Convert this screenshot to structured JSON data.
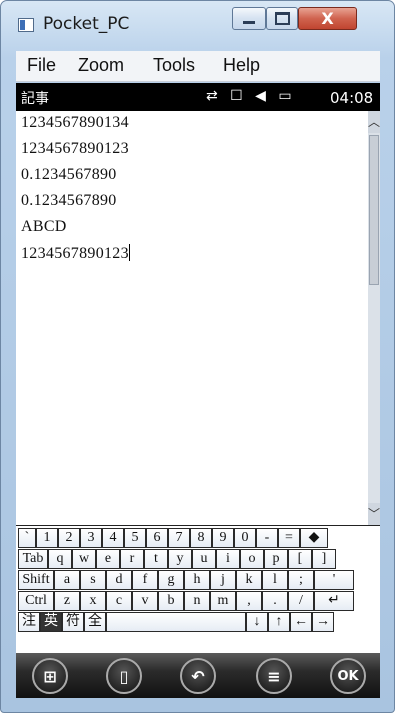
{
  "window": {
    "title": "Pocket_PC",
    "close_glyph": "X"
  },
  "menu": {
    "items": [
      "File",
      "Zoom",
      "Tools",
      "Help"
    ]
  },
  "status": {
    "app_name": "記事",
    "icons": "⇄ ☐ ◀ ▭",
    "time": "04:08"
  },
  "editor": {
    "lines": [
      "1234567890134",
      "1234567890123",
      "0.1234567890",
      "0.1234567890",
      "ABCD",
      "1234567890123"
    ]
  },
  "keyboard": {
    "row1": [
      "`",
      "1",
      "2",
      "3",
      "4",
      "5",
      "6",
      "7",
      "8",
      "9",
      "0",
      "-",
      "=",
      "◆"
    ],
    "row2": [
      "Tab",
      "q",
      "w",
      "e",
      "r",
      "t",
      "y",
      "u",
      "i",
      "o",
      "p",
      "[",
      "]"
    ],
    "row3": [
      "Shift",
      "a",
      "s",
      "d",
      "f",
      "g",
      "h",
      "j",
      "k",
      "l",
      ";",
      "'"
    ],
    "row4": [
      "Ctrl",
      "z",
      "x",
      "c",
      "v",
      "b",
      "n",
      "m",
      ",",
      ".",
      "/",
      "↵"
    ],
    "row5": [
      "注",
      "英",
      "符",
      "全",
      "",
      "↓",
      "↑",
      "←",
      "→"
    ]
  },
  "taskbar": {
    "start_glyph": "⊞",
    "notes_glyph": "▯",
    "undo_glyph": "↶",
    "menu_glyph": "≡",
    "ok_label": "OK"
  },
  "icons": [
    "app-icon",
    "minimize-icon",
    "maximize-icon",
    "close-icon",
    "sync-icon",
    "signal-icon",
    "speaker-icon",
    "battery-icon",
    "scroll-up-icon",
    "scroll-down-icon",
    "windows-start-icon",
    "new-note-icon",
    "undo-icon",
    "menu-icon"
  ]
}
